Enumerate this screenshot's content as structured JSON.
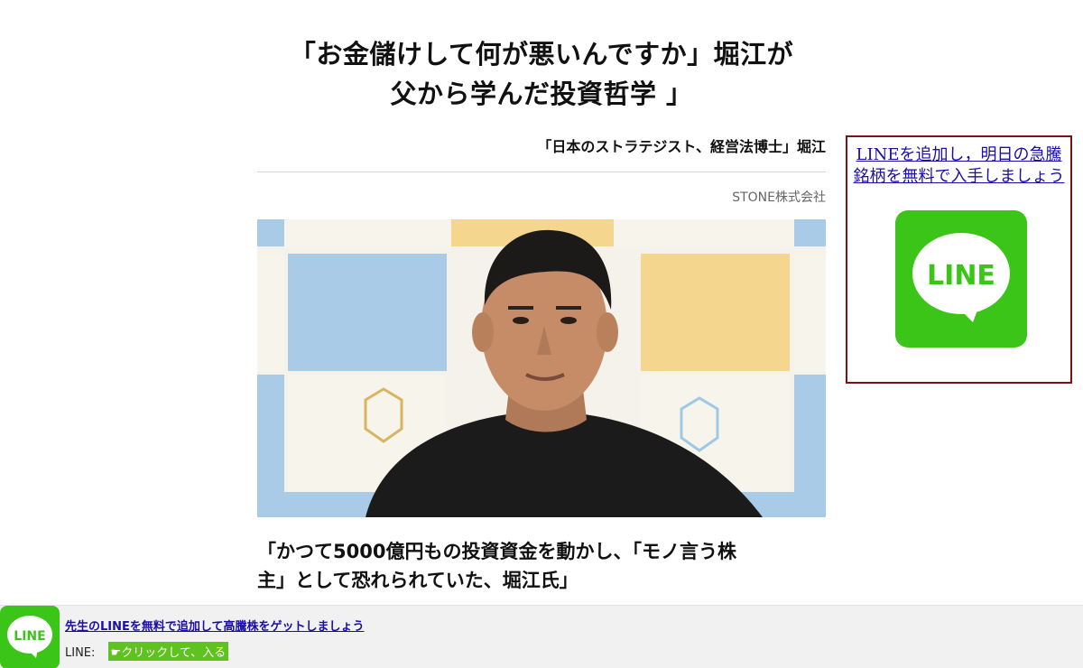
{
  "article": {
    "headline_line1": "「お金儲けして何が悪いんですか」堀江が",
    "headline_line2": "父から学んだ投資哲学 」",
    "byline": "「日本のストラテジスト、経営法博士」堀江",
    "publisher": "STONE株式会社",
    "caption_line1": "「かつて5000億円もの投資資金を動かし、「モノ言う株",
    "caption_line2": "主」として恐れられていた、堀江氏」"
  },
  "side_ad": {
    "link_text": "LINEを追加し，明日の急騰銘柄を無料で入手しましょう",
    "logo_text": "LINE",
    "logo_color": "#3ac518",
    "border_color": "#7a1414"
  },
  "banner": {
    "link_text": "先生のLINEを無料で追加して高騰株をゲットしましょう",
    "label": "LINE:",
    "cta": "☛クリックして、入る",
    "logo_text": "LINE",
    "logo_color": "#3ac518",
    "cta_color": "#5ec21f"
  },
  "icons": {
    "photo": "portrait-photo",
    "side_logo": "line-logo-icon",
    "banner_logo": "line-logo-icon"
  }
}
